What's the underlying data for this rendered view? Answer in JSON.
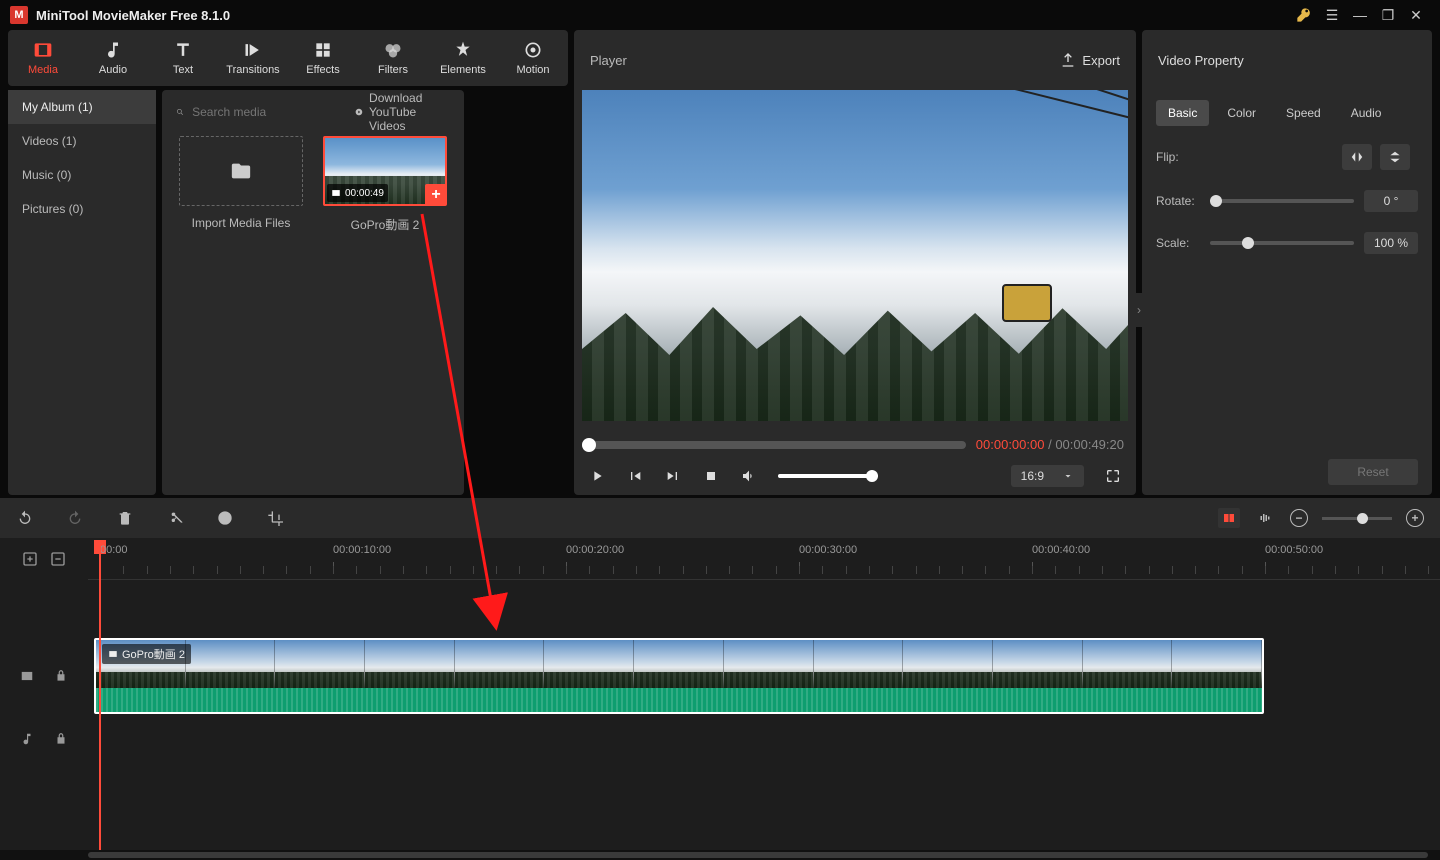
{
  "app": {
    "title": "MiniTool MovieMaker Free 8.1.0"
  },
  "toolbar": {
    "tabs": [
      "Media",
      "Audio",
      "Text",
      "Transitions",
      "Effects",
      "Filters",
      "Elements",
      "Motion"
    ],
    "active": 0
  },
  "media": {
    "sidebar": [
      {
        "label": "My Album (1)",
        "selected": true
      },
      {
        "label": "Videos (1)",
        "selected": false
      },
      {
        "label": "Music (0)",
        "selected": false
      },
      {
        "label": "Pictures (0)",
        "selected": false
      }
    ],
    "search_placeholder": "Search media",
    "download_link": "Download YouTube Videos",
    "import_label": "Import Media Files",
    "clip": {
      "name": "GoPro動画 2",
      "duration": "00:00:49"
    }
  },
  "player": {
    "title": "Player",
    "export": "Export",
    "time_current": "00:00:00:00",
    "time_total": "00:00:49:20",
    "aspect": "16:9"
  },
  "props": {
    "title": "Video Property",
    "tabs": [
      "Basic",
      "Color",
      "Speed",
      "Audio"
    ],
    "active": 0,
    "flip_label": "Flip:",
    "rotate_label": "Rotate:",
    "rotate_value": "0 °",
    "scale_label": "Scale:",
    "scale_value": "100 %",
    "reset": "Reset"
  },
  "timeline": {
    "marks": [
      "00:00",
      "00:00:10:00",
      "00:00:20:00",
      "00:00:30:00",
      "00:00:40:00",
      "00:00:50:00"
    ],
    "clip_name": "GoPro動画 2"
  }
}
